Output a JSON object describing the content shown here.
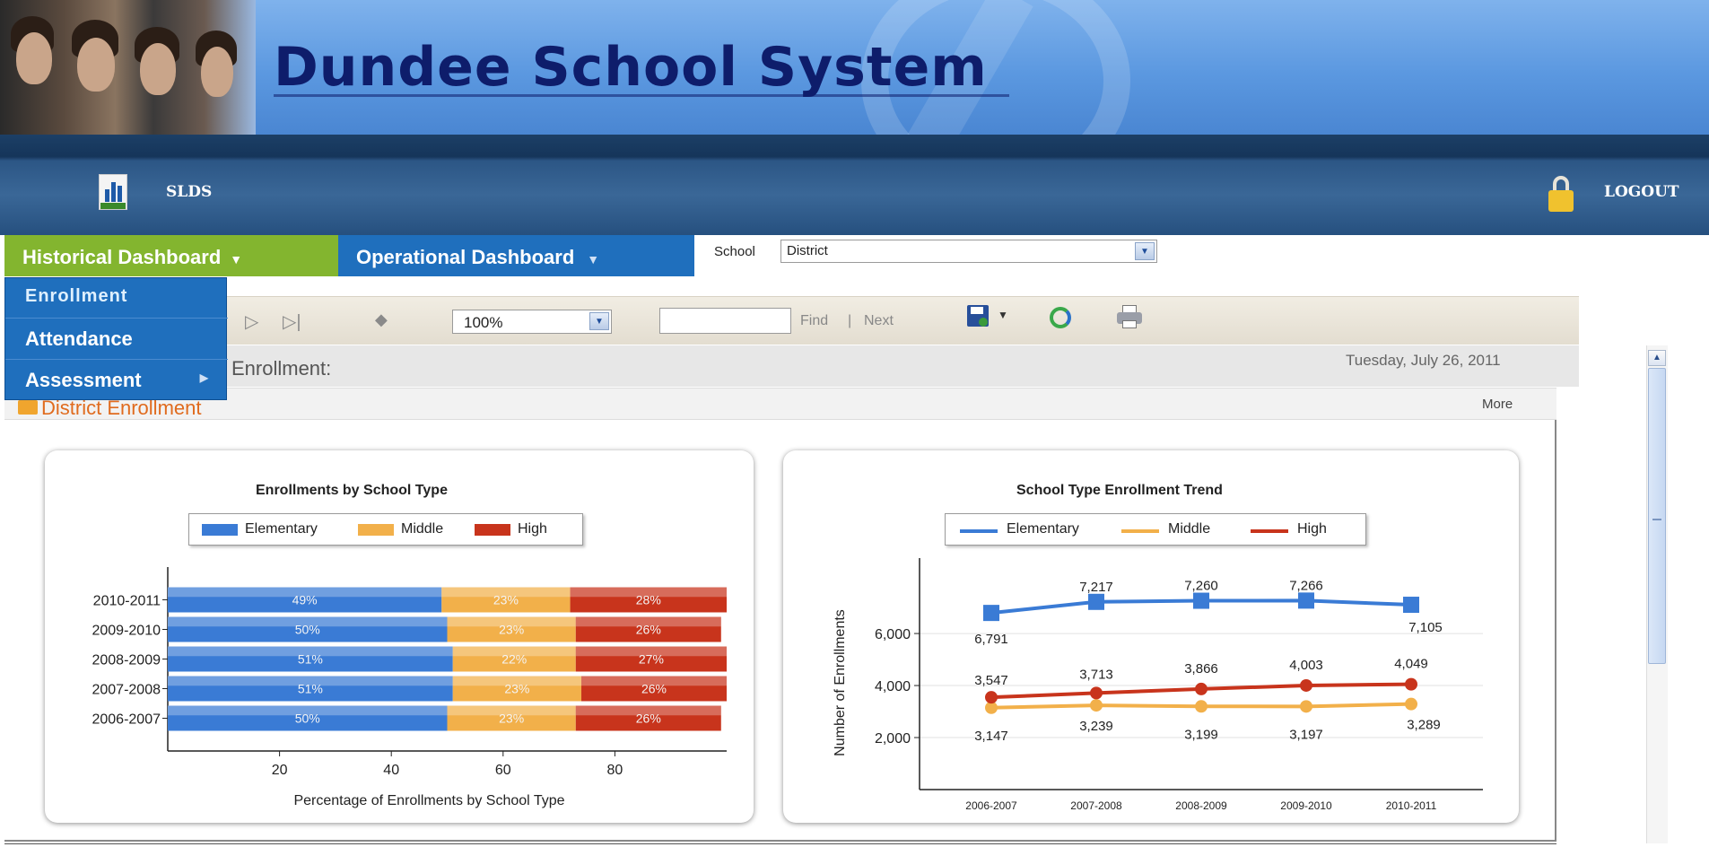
{
  "header": {
    "title": "Dundee School System",
    "app_label": "SLDS",
    "logout_label": "LOGOUT",
    "logo_text": "SLDS"
  },
  "menu": {
    "historical": "Historical Dashboard",
    "operational": "Operational Dashboard",
    "dropdown": [
      "Enrollment",
      "Attendance",
      "Assessment"
    ]
  },
  "filters": {
    "school_label": "School",
    "school_value": "District"
  },
  "toolbar": {
    "zoom": "100%",
    "find": "Find",
    "separator": "|",
    "next": "Next",
    "find_value": ""
  },
  "report": {
    "title": "Enrollment:",
    "date": "Tuesday, July 26, 2011",
    "section_title": "District Enrollment",
    "more": "More"
  },
  "colors": {
    "elementary": "#3a7bd5",
    "middle": "#f2b04a",
    "high": "#c8341c",
    "menu_green": "#83b52f",
    "menu_blue": "#1f6fbd"
  },
  "chart_data": [
    {
      "type": "bar",
      "orientation": "horizontal",
      "stacked": true,
      "title": "Enrollments by School Type",
      "xlabel": "Percentage of Enrollments by School Type",
      "ylabel": "",
      "categories": [
        "2006-2007",
        "2007-2008",
        "2008-2009",
        "2009-2010",
        "2010-2011"
      ],
      "xlim": [
        0,
        100
      ],
      "xticks": [
        20,
        40,
        60,
        80
      ],
      "legend": "top",
      "series": [
        {
          "name": "Elementary",
          "values": [
            50,
            51,
            51,
            50,
            49
          ]
        },
        {
          "name": "Middle",
          "values": [
            23,
            23,
            22,
            23,
            23
          ]
        },
        {
          "name": "High",
          "values": [
            26,
            26,
            27,
            26,
            28
          ]
        }
      ],
      "data_labels": {
        "Elementary": [
          "50%",
          "51%",
          "51%",
          "50%",
          "49%"
        ],
        "Middle": [
          "23%",
          "23%",
          "22%",
          "23%",
          "23%"
        ],
        "High": [
          "26%",
          "26%",
          "27%",
          "26%",
          "28%"
        ]
      }
    },
    {
      "type": "line",
      "title": "School Type Enrollment Trend",
      "xlabel": "",
      "ylabel": "Number of Enrollments",
      "categories": [
        "2006-2007",
        "2007-2008",
        "2008-2009",
        "2009-2010",
        "2010-2011"
      ],
      "ylim": [
        0,
        8900
      ],
      "yticks": [
        "2,000",
        "4,000",
        "6,000"
      ],
      "ytick_values": [
        2000,
        4000,
        6000
      ],
      "legend": "top",
      "grid": true,
      "series": [
        {
          "name": "Elementary",
          "values": [
            6791,
            7217,
            7260,
            7266,
            7105
          ],
          "labels": [
            "6,791",
            "7,217",
            "7,260",
            "7,266",
            "7,105"
          ]
        },
        {
          "name": "Middle",
          "values": [
            3147,
            3239,
            3199,
            3197,
            3289
          ],
          "labels": [
            "3,147",
            "3,239",
            "3,199",
            "3,197",
            "3,289"
          ]
        },
        {
          "name": "High",
          "values": [
            3547,
            3713,
            3866,
            4003,
            4049
          ],
          "labels": [
            "3,547",
            "3,713",
            "3,866",
            "4,003",
            "4,049"
          ]
        }
      ]
    }
  ]
}
